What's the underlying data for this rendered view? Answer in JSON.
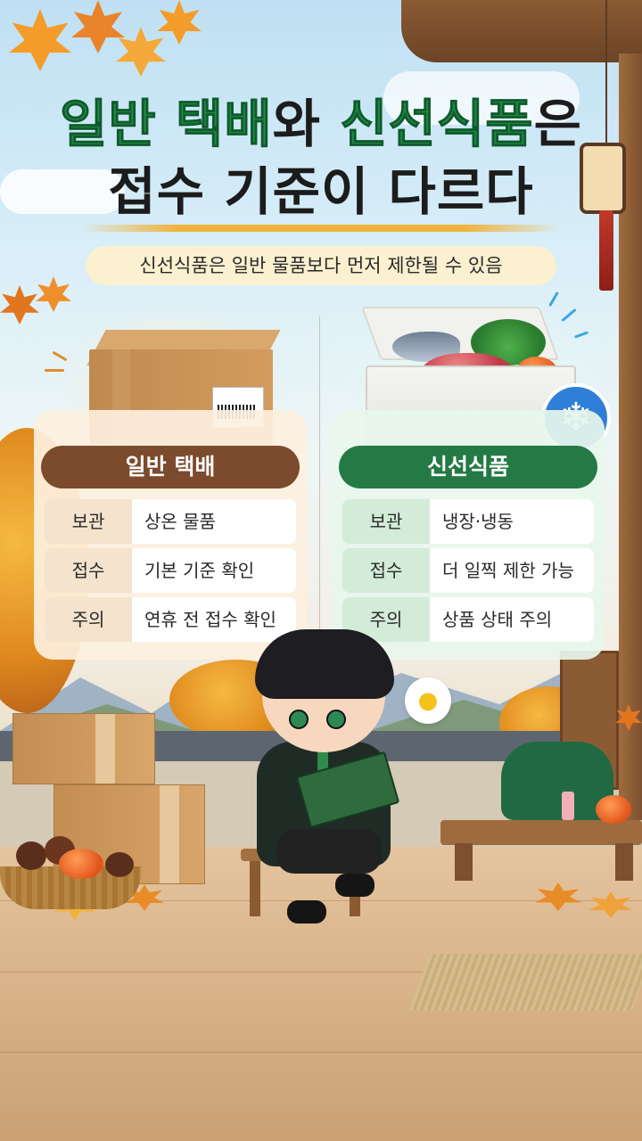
{
  "headline": {
    "line1_green_a": "일반 택배",
    "line1_dark": "와 ",
    "line1_green_b": "신선식품",
    "line1_end": "은",
    "line2": "접수 기준이 다르다"
  },
  "subtitle": "신선식품은 일반 물품보다 먼저 제한될 수 있음",
  "panels": [
    {
      "title": "일반 택배",
      "rows": [
        {
          "key": "보관",
          "value": "상온 물품"
        },
        {
          "key": "접수",
          "value": "기본 기준 확인"
        },
        {
          "key": "주의",
          "value": "연휴 전 접수 확인"
        }
      ]
    },
    {
      "title": "신선식품",
      "rows": [
        {
          "key": "보관",
          "value": "냉장·냉동"
        },
        {
          "key": "접수",
          "value": "더 일찍 제한 가능"
        },
        {
          "key": "주의",
          "value": "상품 상태 주의"
        }
      ]
    }
  ],
  "icons": {
    "parcel": "cardboard-box-icon",
    "cooler": "fresh-food-cooler-icon",
    "snowflake": "snowflake-icon",
    "lightbulb": "lightbulb-icon"
  },
  "colors": {
    "headline_green": "#1f8a45",
    "general_header": "#7c4a2c",
    "fresh_header": "#247a44",
    "snow_badge": "#2f7fd8"
  }
}
